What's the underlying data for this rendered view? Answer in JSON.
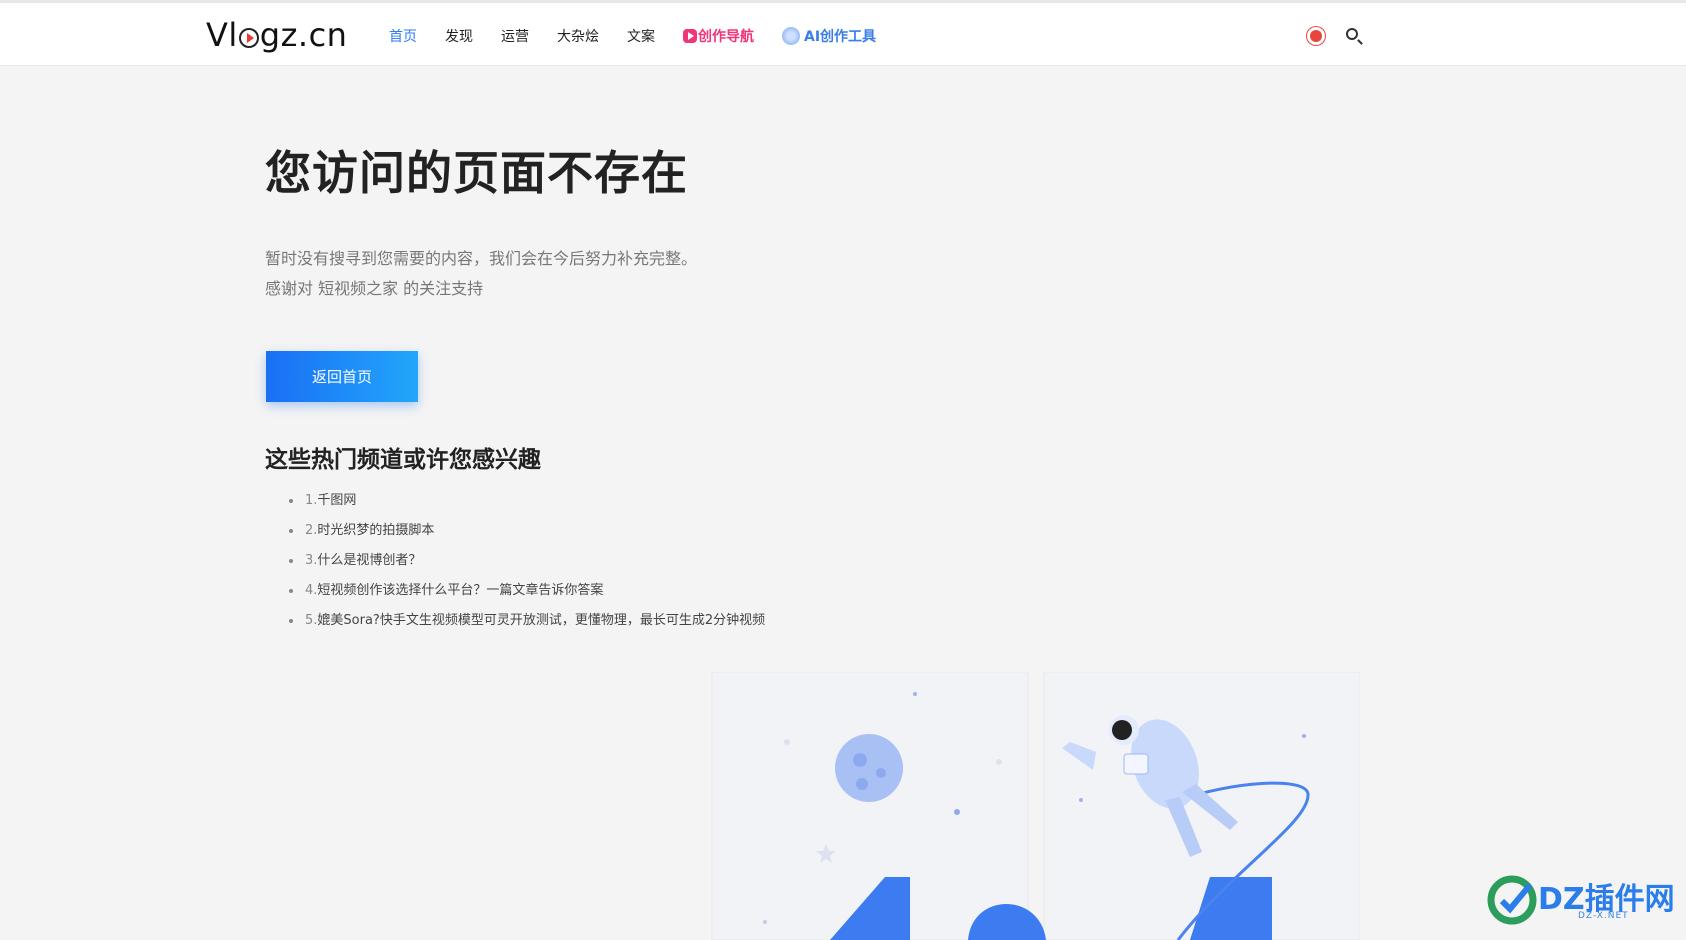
{
  "header": {
    "logo": "Vlogz.cn",
    "logo_parts": [
      "Vl",
      "gz.cn"
    ],
    "nav": [
      {
        "label": "首页",
        "active": true
      },
      {
        "label": "发现"
      },
      {
        "label": "运营"
      },
      {
        "label": "大杂烩"
      },
      {
        "label": "文案"
      },
      {
        "label": "创作导航",
        "icon": "play-icon"
      },
      {
        "label": "AI创作工具",
        "icon": "ai-icon"
      }
    ],
    "theme_icon": "sun-icon",
    "search_icon": "search-icon"
  },
  "main": {
    "title": "您访问的页面不存在",
    "desc_line1": "暂时没有搜寻到您需要的内容，我们会在今后努力补充完整。",
    "desc_line2": "感谢对 短视频之家 的关注支持",
    "home_button": "返回首页",
    "channels_title": "这些热门频道或许您感兴趣",
    "channels": [
      {
        "num": "1.",
        "text": "千图网"
      },
      {
        "num": "2.",
        "text": "时光织梦的拍摄脚本"
      },
      {
        "num": "3.",
        "text": "什么是视博创者？"
      },
      {
        "num": "4.",
        "text": "短视频创作该选择什么平台？一篇文章告诉你答案"
      },
      {
        "num": "5.",
        "text": "媲美Sora?快手文生视频模型可灵开放测试，更懂物理，最长可生成2分钟视频"
      }
    ]
  },
  "watermark": {
    "text": "DZ插件网",
    "sub": "DZ-X.NET"
  },
  "colors": {
    "accent": "#2d7cf6",
    "pink": "#f0357a",
    "illustration_blue": "#3d7cf0"
  }
}
